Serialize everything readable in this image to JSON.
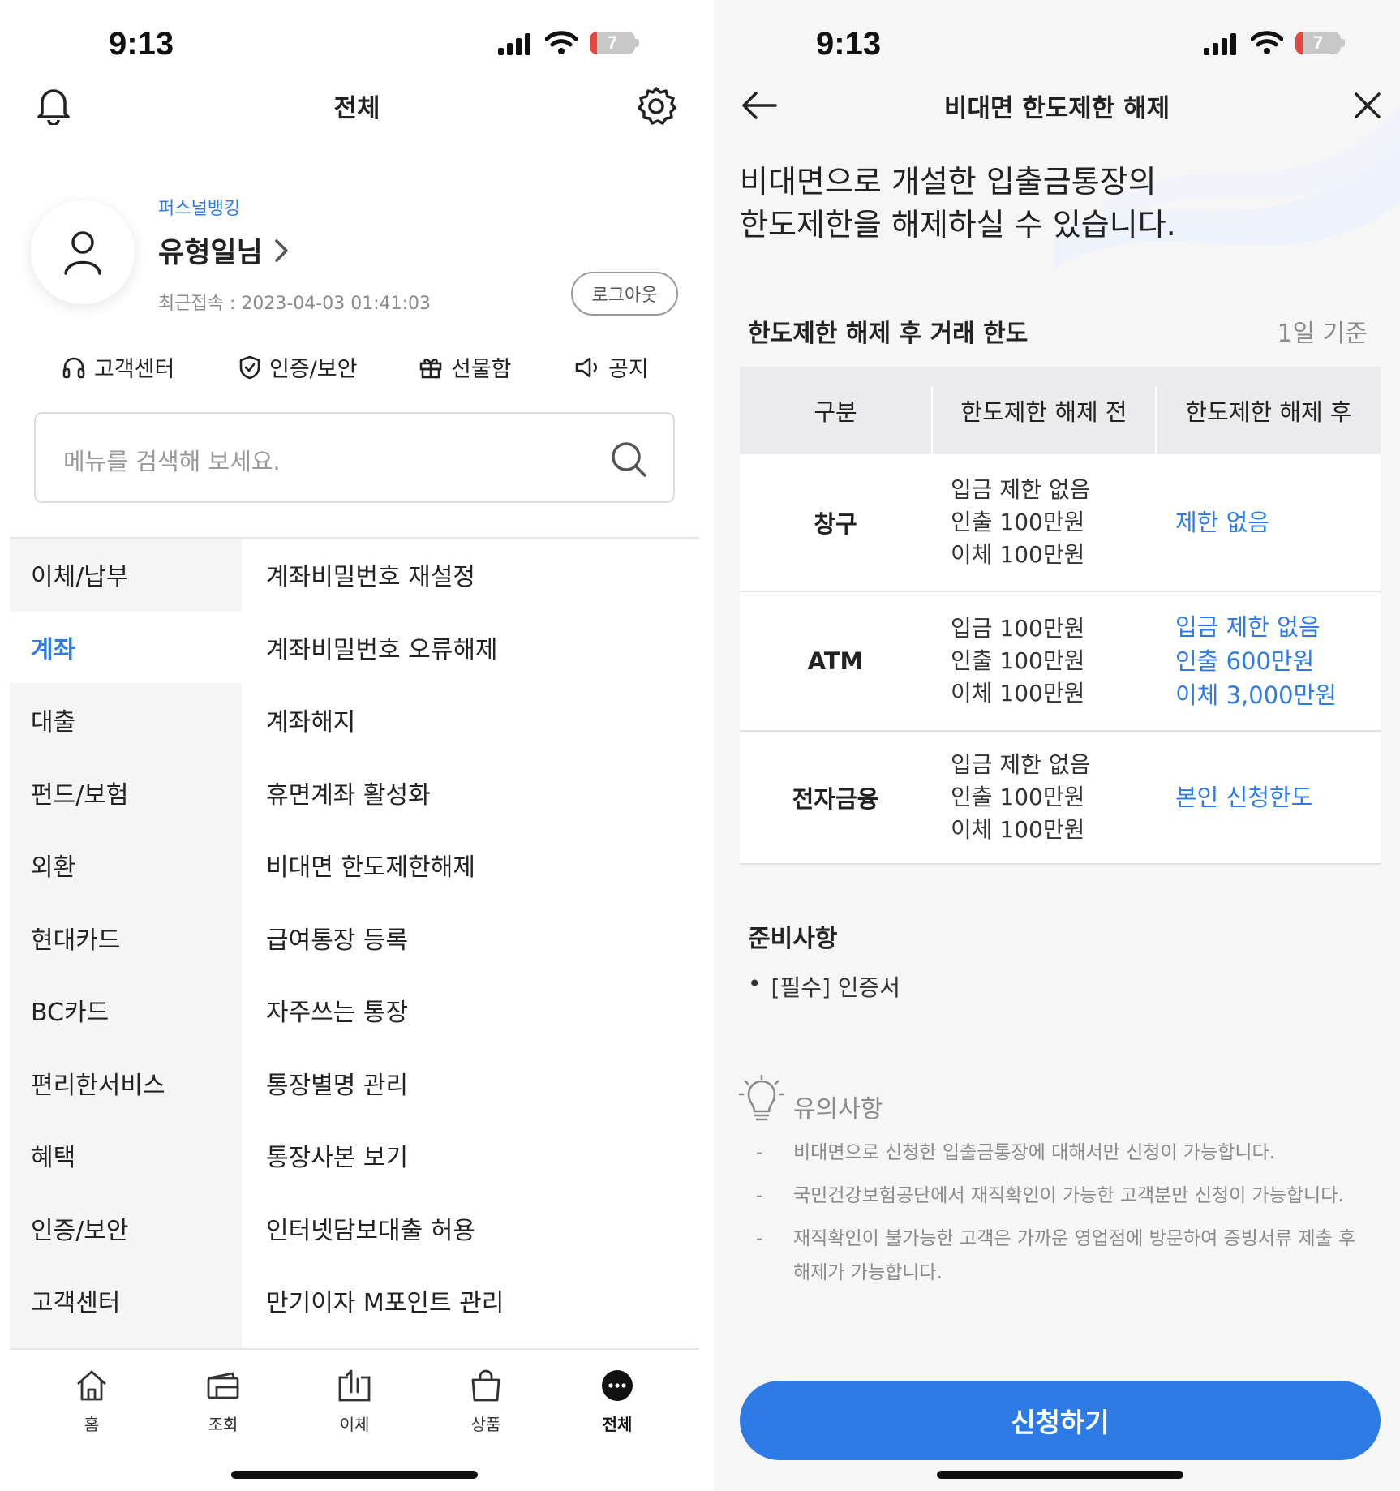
{
  "left": {
    "status": {
      "time": "9:13",
      "battery": "7"
    },
    "header": {
      "title": "전체"
    },
    "profile": {
      "grade": "퍼스널뱅킹",
      "name": "유형일님",
      "last_login": "최근접속 : 2023-04-03 01:41:03",
      "logout": "로그아웃"
    },
    "quick_menu": [
      {
        "label": "고객센터",
        "icon": "headset-icon"
      },
      {
        "label": "인증/보안",
        "icon": "shield-check-icon"
      },
      {
        "label": "선물함",
        "icon": "gift-icon"
      },
      {
        "label": "공지",
        "icon": "megaphone-icon"
      }
    ],
    "search": {
      "placeholder": "메뉴를 검색해 보세요."
    },
    "categories": [
      "이체/납부",
      "계좌",
      "대출",
      "펀드/보험",
      "외환",
      "현대카드",
      "BC카드",
      "편리한서비스",
      "혜택",
      "인증/보안",
      "고객센터"
    ],
    "selected_category": "계좌",
    "submenu": [
      "계좌비밀번호 재설정",
      "계좌비밀번호 오류해제",
      "계좌해지",
      "휴면계좌 활성화",
      "비대면 한도제한해제",
      "급여통장 등록",
      "자주쓰는 통장",
      "통장별명 관리",
      "통장사본 보기",
      "인터넷담보대출 허용",
      "만기이자 M포인트 관리"
    ],
    "tabbar": [
      {
        "label": "홈",
        "icon": "home-icon"
      },
      {
        "label": "조회",
        "icon": "wallet-icon"
      },
      {
        "label": "이체",
        "icon": "transfer-icon"
      },
      {
        "label": "상품",
        "icon": "shopping-bag-icon"
      },
      {
        "label": "전체",
        "icon": "more-icon",
        "active": true
      }
    ]
  },
  "right": {
    "status": {
      "time": "9:13",
      "battery": "7"
    },
    "header": {
      "title": "비대면 한도제한 해제"
    },
    "intro": [
      "비대면으로 개설한 입출금통장의",
      "한도제한을 해제하실 수 있습니다."
    ],
    "limits": {
      "title": "한도제한 해제 후 거래 한도",
      "basis": "1일 기준",
      "columns": [
        "구분",
        "한도제한 해제 전",
        "한도제한 해제 후"
      ],
      "rows": [
        {
          "name": "창구",
          "before": [
            "입금 제한 없음",
            "인출 100만원",
            "이체 100만원"
          ],
          "after": [
            "제한 없음"
          ]
        },
        {
          "name": "ATM",
          "before": [
            "입금 100만원",
            "인출 100만원",
            "이체 100만원"
          ],
          "after": [
            "입금 제한 없음",
            "인출 600만원",
            "이체 3,000만원"
          ]
        },
        {
          "name": "전자금융",
          "before": [
            "입금 제한 없음",
            "인출 100만원",
            "이체 100만원"
          ],
          "after": [
            "본인 신청한도"
          ]
        }
      ]
    },
    "preparation": {
      "title": "준비사항",
      "items": [
        "[필수] 인증서"
      ]
    },
    "notes": {
      "title": "유의사항",
      "items": [
        "비대면으로 신청한 입출금통장에 대해서만 신청이 가능합니다.",
        "국민건강보험공단에서 재직확인이 가능한 고객분만 신청이 가능합니다.",
        "재직확인이 불가능한 고객은 가까운 영업점에 방문하여 증빙서류 제출 후 해제가 가능합니다."
      ]
    },
    "apply": "신청하기"
  },
  "colors": {
    "accent": "#2f7be6",
    "menu_bg": "#f5f5f6",
    "table_header": "#ebebed"
  }
}
